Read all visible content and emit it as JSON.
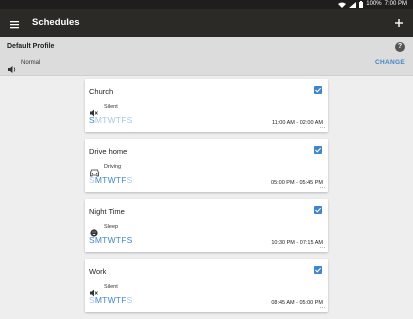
{
  "status": {
    "battery": "100%",
    "time": "7:00 PM"
  },
  "appbar": {
    "title": "Schedules"
  },
  "profile": {
    "name": "Default Profile",
    "mode": "Normal",
    "change_label": "CHANGE"
  },
  "schedules": [
    {
      "title": "Church",
      "mode": "Silent",
      "mode_icon": "speaker-muted-icon",
      "days": [
        "S",
        "M",
        "T",
        "W",
        "T",
        "F",
        "S"
      ],
      "active_days": [
        true,
        false,
        false,
        false,
        false,
        false,
        false
      ],
      "time": "11:00 AM - 02:00 AM",
      "enabled": true
    },
    {
      "title": "Drive home",
      "mode": "Driving",
      "mode_icon": "car-icon",
      "days": [
        "S",
        "M",
        "T",
        "W",
        "T",
        "F",
        "S"
      ],
      "active_days": [
        false,
        true,
        true,
        true,
        true,
        true,
        false
      ],
      "time": "05:00 PM - 05:45 PM",
      "enabled": true
    },
    {
      "title": "Night Time",
      "mode": "Sleep",
      "mode_icon": "sleep-icon",
      "days": [
        "S",
        "M",
        "T",
        "W",
        "T",
        "F",
        "S"
      ],
      "active_days": [
        true,
        true,
        true,
        true,
        true,
        true,
        true
      ],
      "time": "10:30 PM - 07:15 AM",
      "enabled": true
    },
    {
      "title": "Work",
      "mode": "Silent",
      "mode_icon": "speaker-muted-icon",
      "days": [
        "S",
        "M",
        "T",
        "W",
        "T",
        "F",
        "S"
      ],
      "active_days": [
        false,
        true,
        true,
        true,
        true,
        true,
        false
      ],
      "time": "08:45 AM - 05:00 PM",
      "enabled": true
    }
  ],
  "colors": {
    "accent": "#3f85c9",
    "appbar": "#2b2a27",
    "statusbar": "#1f1e1c",
    "profile_bg": "#dcdcdc",
    "background": "#eeeeee"
  }
}
